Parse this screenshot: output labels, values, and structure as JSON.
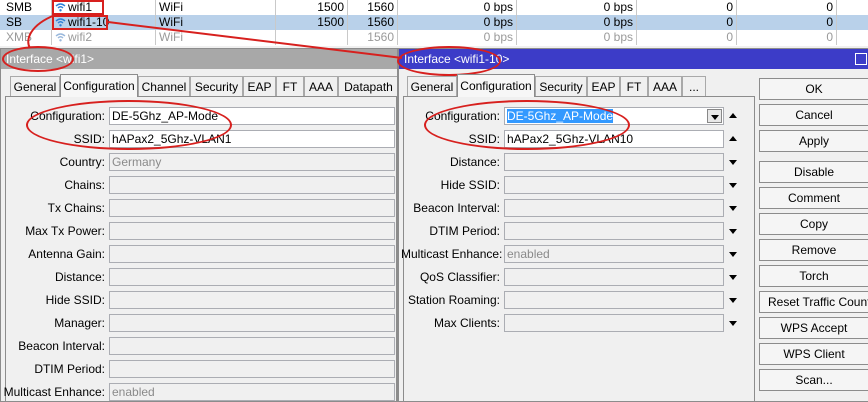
{
  "interface_list": {
    "rows": [
      {
        "flags": "SMB",
        "name": "wifi1",
        "type": "WiFi",
        "actual_mtu": "1500",
        "l2_mtu": "1560",
        "tx": "0 bps",
        "rx": "0 bps",
        "tx_packets": "0",
        "rx_packets": "0",
        "state": "normal"
      },
      {
        "flags": "SB",
        "name": "wifi1-10",
        "type": "WiFi",
        "actual_mtu": "1500",
        "l2_mtu": "1560",
        "tx": "0 bps",
        "rx": "0 bps",
        "tx_packets": "0",
        "rx_packets": "0",
        "state": "selected"
      },
      {
        "flags": "XMB",
        "name": "wifi2",
        "type": "WiFi",
        "actual_mtu": "",
        "l2_mtu": "1560",
        "tx": "0 bps",
        "rx": "0 bps",
        "tx_packets": "0",
        "rx_packets": "0",
        "state": "disabled"
      }
    ]
  },
  "left_window": {
    "title": "Interface <wifi1>",
    "tabs": [
      "General",
      "Configuration",
      "Channel",
      "Security",
      "EAP",
      "FT",
      "AAA",
      "Datapath"
    ],
    "active_tab": "Configuration",
    "fields": [
      {
        "label": "Configuration:",
        "value": "DE-5Ghz_AP-Mode"
      },
      {
        "label": "SSID:",
        "value": "hAPax2_5Ghz-VLAN1"
      },
      {
        "label": "Country:",
        "value": "Germany"
      },
      {
        "label": "Chains:",
        "value": ""
      },
      {
        "label": "Tx Chains:",
        "value": ""
      },
      {
        "label": "Max Tx Power:",
        "value": ""
      },
      {
        "label": "Antenna Gain:",
        "value": ""
      },
      {
        "label": "Distance:",
        "value": ""
      },
      {
        "label": "Hide SSID:",
        "value": ""
      },
      {
        "label": "Manager:",
        "value": ""
      },
      {
        "label": "Beacon Interval:",
        "value": ""
      },
      {
        "label": "DTIM Period:",
        "value": ""
      },
      {
        "label": "Multicast Enhance:",
        "value": "enabled"
      }
    ]
  },
  "right_window": {
    "title": "Interface <wifi1-10>",
    "tabs": [
      "General",
      "Configuration",
      "Security",
      "EAP",
      "FT",
      "AAA",
      "..."
    ],
    "active_tab": "Configuration",
    "fields": [
      {
        "label": "Configuration:",
        "value": "DE-5Ghz_AP-Mode"
      },
      {
        "label": "SSID:",
        "value": "hAPax2_5Ghz-VLAN10"
      },
      {
        "label": "Distance:",
        "value": ""
      },
      {
        "label": "Hide SSID:",
        "value": ""
      },
      {
        "label": "Beacon Interval:",
        "value": ""
      },
      {
        "label": "DTIM Period:",
        "value": ""
      },
      {
        "label": "Multicast Enhance:",
        "value": "enabled"
      },
      {
        "label": "QoS Classifier:",
        "value": ""
      },
      {
        "label": "Station Roaming:",
        "value": ""
      },
      {
        "label": "Max Clients:",
        "value": ""
      }
    ],
    "buttons": [
      "OK",
      "Cancel",
      "Apply",
      "Disable",
      "Comment",
      "Copy",
      "Remove",
      "Torch",
      "Reset Traffic Counters",
      "WPS Accept",
      "WPS Client",
      "Scan..."
    ]
  },
  "colors": {
    "left_title_bar": "#a8a8a8",
    "right_title_bar": "#3c3cc8",
    "selected_row": "#b9d1ea",
    "highlight": "#3399ff",
    "annotation_red": "#d7201e",
    "wifi_icon": "#2f7fd6"
  },
  "icons": {
    "interface_icon": "wifi-icon"
  }
}
